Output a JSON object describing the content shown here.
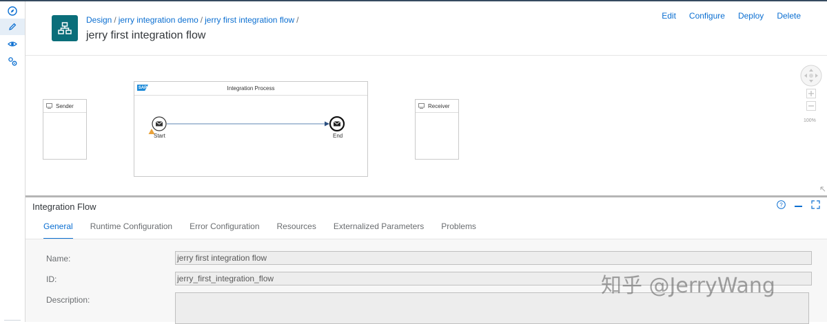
{
  "header": {
    "breadcrumb": [
      "Design",
      "jerry integration demo",
      "jerry first integration flow"
    ],
    "breadcrumb_sep": "/",
    "title": "jerry first integration flow",
    "actions": [
      "Edit",
      "Configure",
      "Deploy",
      "Delete"
    ],
    "icon": "integration-flow-icon"
  },
  "rail": {
    "items": [
      "discover-icon",
      "design-pencil-icon",
      "monitor-eye-icon",
      "settings-gears-icon"
    ],
    "active_index": 1
  },
  "diagram": {
    "sender_label": "Sender",
    "receiver_label": "Receiver",
    "process_title": "Integration Process",
    "sap_logo": "SAP",
    "start_label": "Start",
    "end_label": "End",
    "zoom_label": "100%"
  },
  "panel": {
    "title": "Integration Flow",
    "tabs": [
      "General",
      "Runtime Configuration",
      "Error Configuration",
      "Resources",
      "Externalized Parameters",
      "Problems"
    ],
    "active_tab": 0,
    "fields": {
      "name_label": "Name:",
      "name_value": "jerry first integration flow",
      "id_label": "ID:",
      "id_value": "jerry_first_integration_flow",
      "description_label": "Description:",
      "description_value": ""
    }
  },
  "watermark": "知乎 @JerryWang",
  "colors": {
    "accent": "#0a6ed1",
    "header_icon_bg": "#0a6e7a",
    "warning": "#e9a23b",
    "flow_line": "#5d86b3"
  }
}
